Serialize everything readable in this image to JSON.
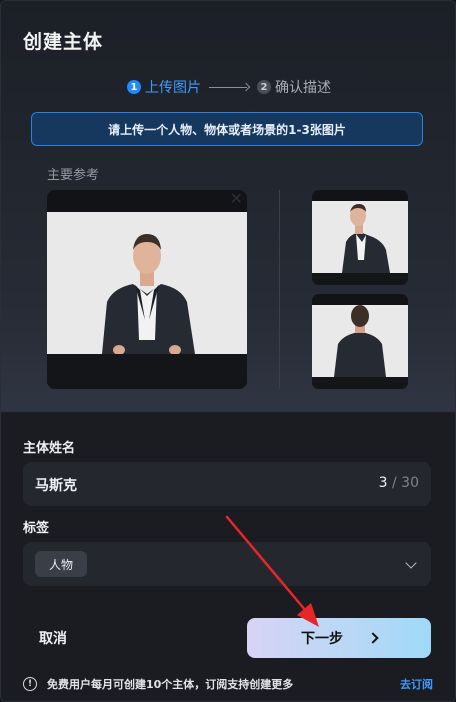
{
  "dialog": {
    "title": "创建主体"
  },
  "steps": [
    {
      "number": "1",
      "label": "上传图片",
      "active": true
    },
    {
      "number": "2",
      "label": "确认描述",
      "active": false
    }
  ],
  "banner": {
    "text": "请上传一个人物、物体或者场景的1-3张图片"
  },
  "reference": {
    "label": "主要参考",
    "close_glyph": "✕"
  },
  "form": {
    "name_label": "主体姓名",
    "name_value": "马斯克",
    "name_count": "3",
    "name_sep": "/",
    "name_max": "30",
    "tags_label": "标签",
    "tag_value": "人物"
  },
  "buttons": {
    "cancel": "取消",
    "next": "下一步"
  },
  "footer": {
    "info_glyph": "!",
    "notice": "免费用户每月可创建10个主体，订阅支持创建更多",
    "subscribe": "去订阅"
  },
  "colors": {
    "accent": "#1e8cff",
    "annotation_arrow": "#e8262a"
  }
}
